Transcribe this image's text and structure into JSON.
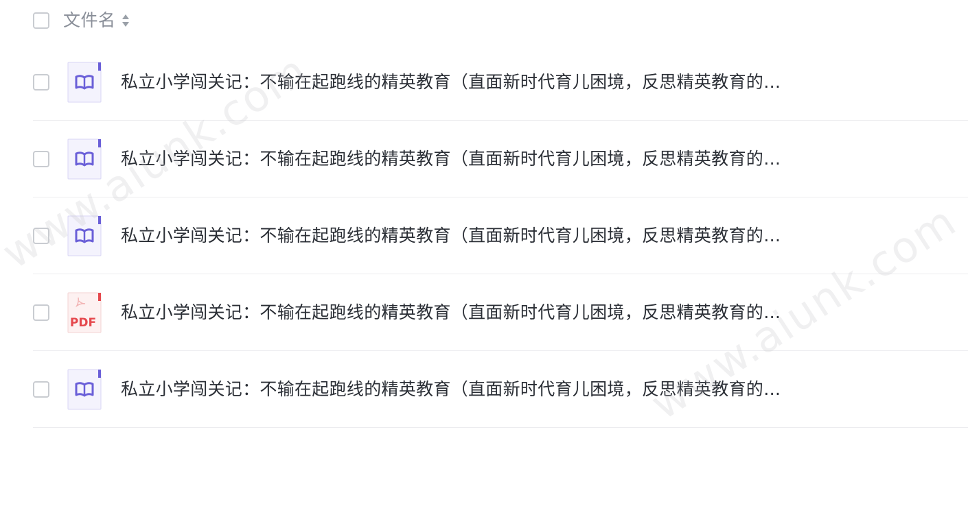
{
  "header": {
    "column_label": "文件名"
  },
  "files": [
    {
      "name": "私立小学闯关记：不输在起跑线的精英教育（直面新时代育儿困境，反思精英教育的…",
      "type": "epub"
    },
    {
      "name": "私立小学闯关记：不输在起跑线的精英教育（直面新时代育儿困境，反思精英教育的…",
      "type": "epub"
    },
    {
      "name": "私立小学闯关记：不输在起跑线的精英教育（直面新时代育儿困境，反思精英教育的…",
      "type": "epub"
    },
    {
      "name": "私立小学闯关记：不输在起跑线的精英教育（直面新时代育儿困境，反思精英教育的…",
      "type": "pdf"
    },
    {
      "name": "私立小学闯关记：不输在起跑线的精英教育（直面新时代育儿困境，反思精英教育的…",
      "type": "epub"
    }
  ],
  "icons": {
    "epub": "book-icon",
    "pdf": "pdf-icon",
    "sort": "sort-icon"
  },
  "pdf_label": "PDF",
  "watermarks": [
    "www.aiunk.com",
    "www.aiunk.com"
  ],
  "colors": {
    "epub_accent": "#6a5fd8",
    "epub_bg": "#f4f3fd",
    "pdf_accent": "#e5484d",
    "pdf_bg": "#fdf1f1"
  }
}
